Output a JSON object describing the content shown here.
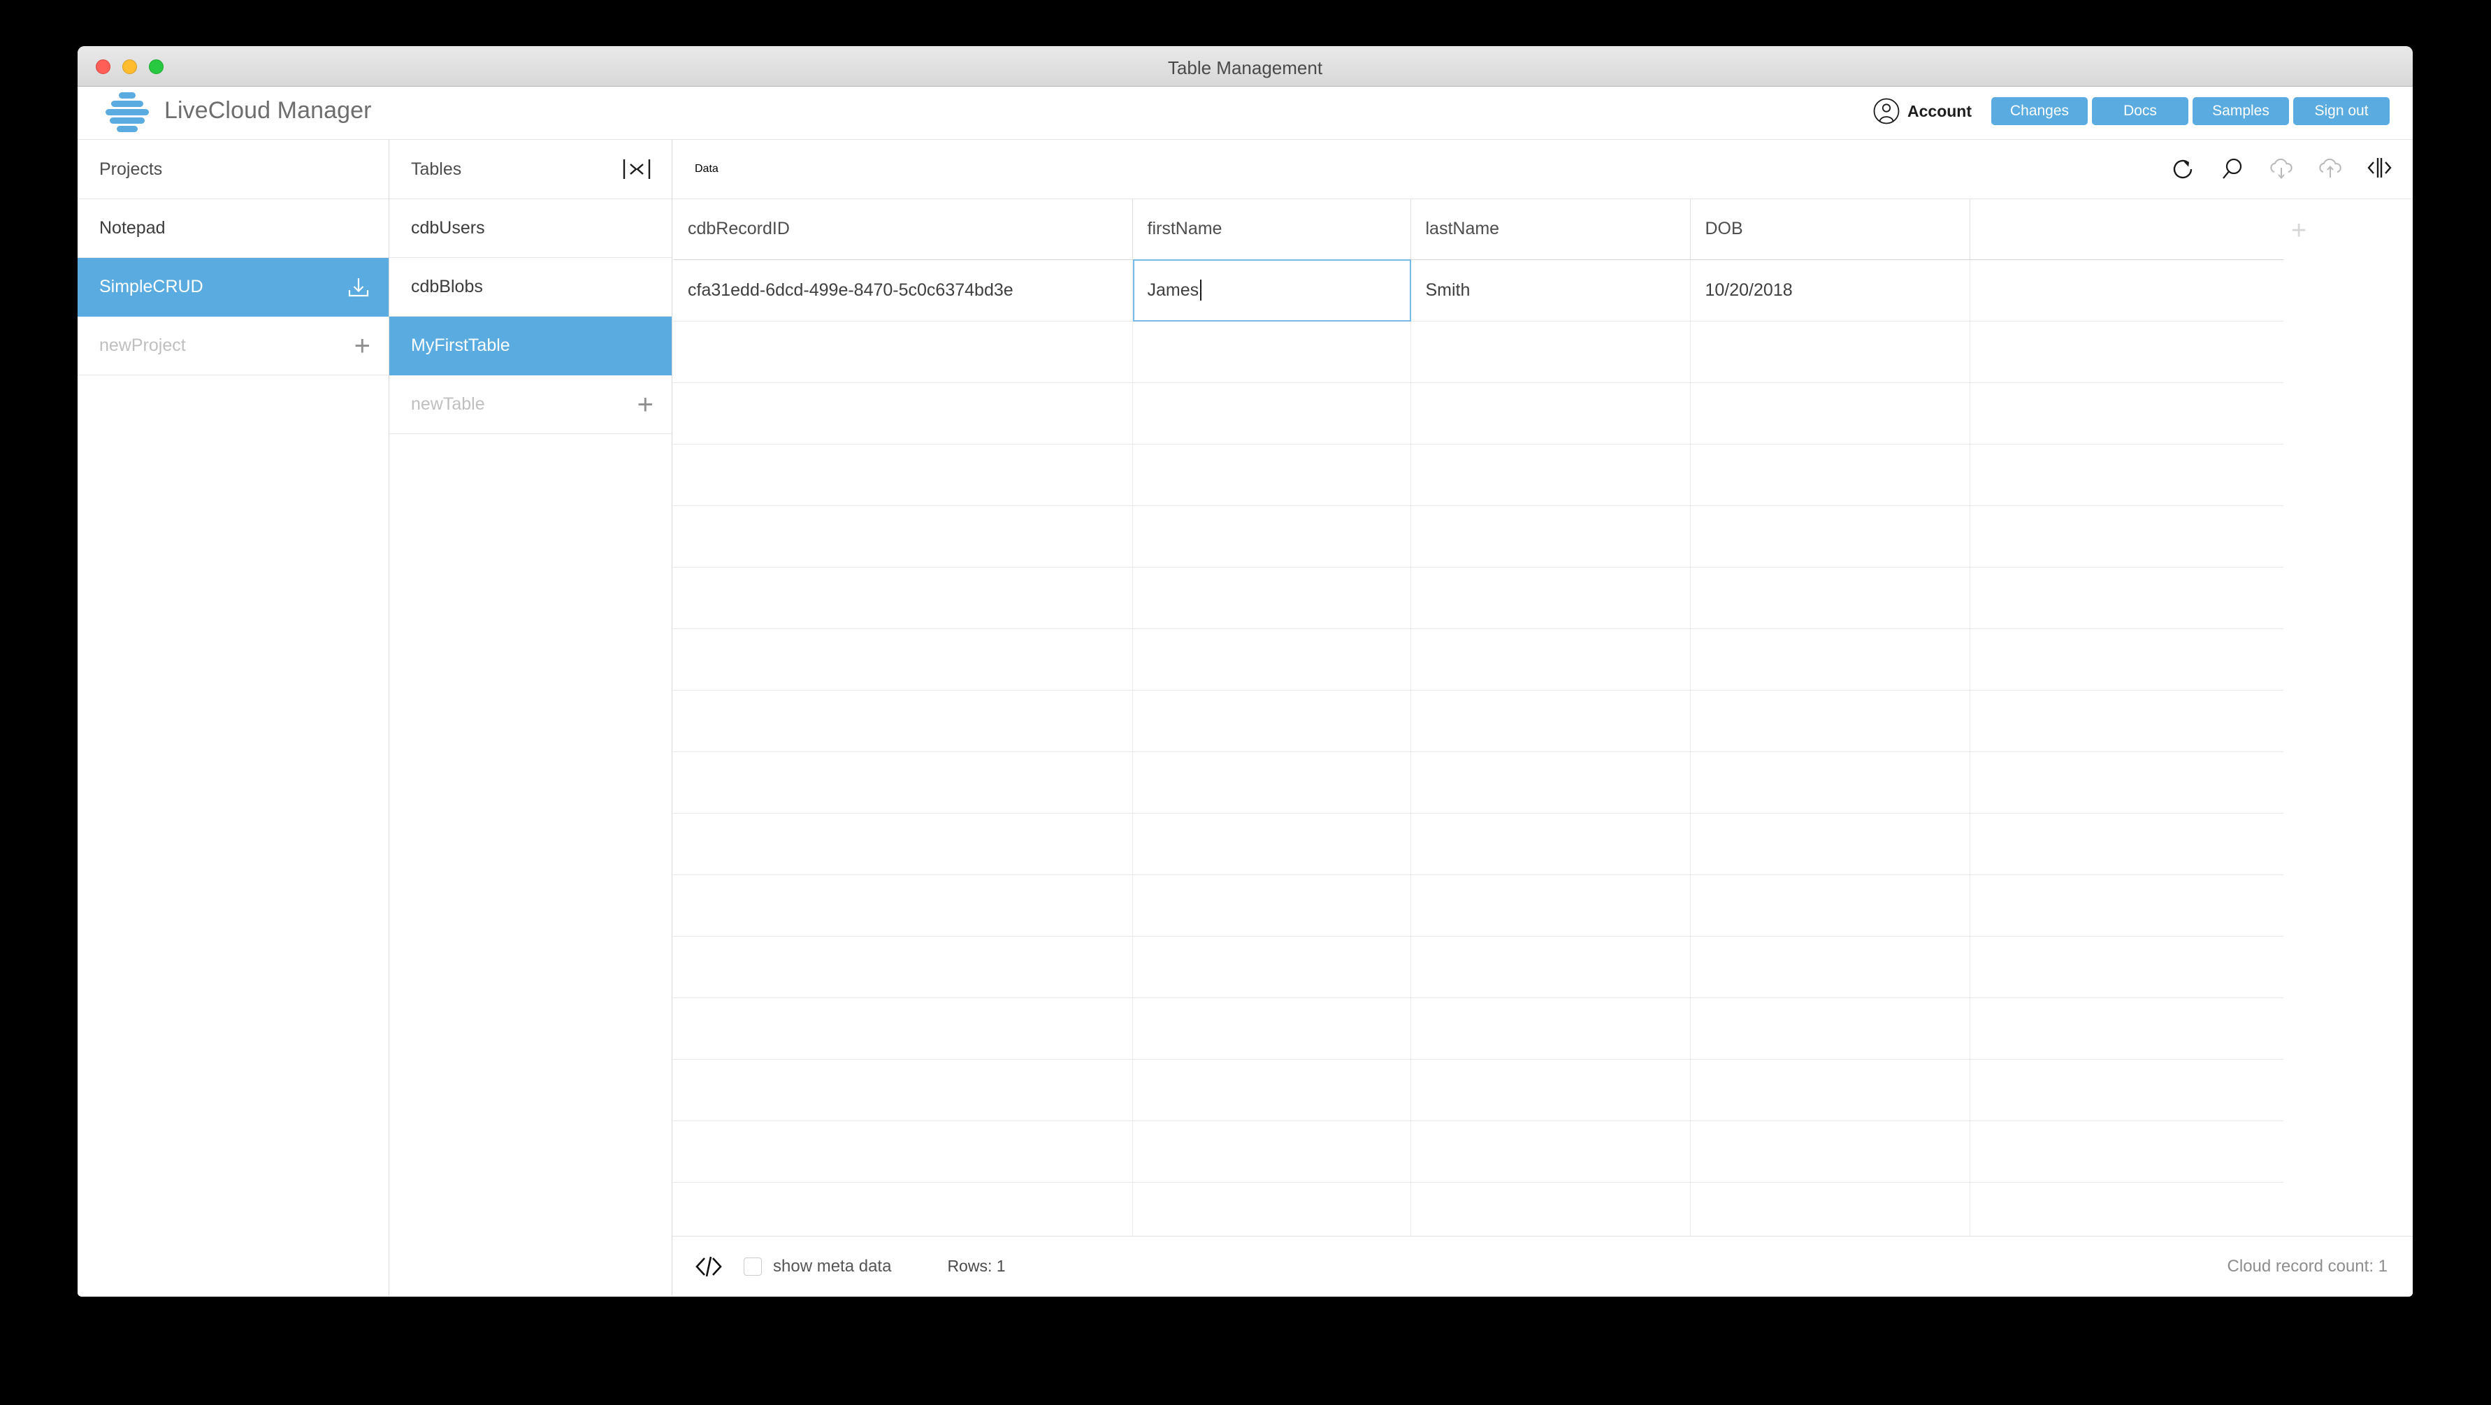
{
  "window": {
    "title": "Table Management",
    "traffic_lights": [
      "close",
      "minimize",
      "zoom"
    ]
  },
  "header": {
    "brand_name": "LiveCloud Manager",
    "logo_icon": "livecloud-stack-logo",
    "account_icon": "account-person-icon",
    "account_label": "Account",
    "buttons": [
      {
        "label": "Changes",
        "name": "changes-button"
      },
      {
        "label": "Docs",
        "name": "docs-button"
      },
      {
        "label": "Samples",
        "name": "samples-button"
      },
      {
        "label": "Sign out",
        "name": "sign-out-button"
      }
    ],
    "accent_color": "#5aabe0"
  },
  "projects_panel": {
    "title": "Projects",
    "items": [
      {
        "label": "Notepad",
        "selected": false,
        "placeholder": false,
        "icon": ""
      },
      {
        "label": "SimpleCRUD",
        "selected": true,
        "placeholder": false,
        "icon": "download-icon"
      },
      {
        "label": "newProject",
        "selected": false,
        "placeholder": true,
        "icon": "plus-icon"
      }
    ]
  },
  "tables_panel": {
    "title": "Tables",
    "collapse_icon": "collapse-horizontal-icon",
    "items": [
      {
        "label": "cdbUsers",
        "selected": false,
        "placeholder": false,
        "icon": ""
      },
      {
        "label": "cdbBlobs",
        "selected": false,
        "placeholder": false,
        "icon": ""
      },
      {
        "label": "MyFirstTable",
        "selected": true,
        "placeholder": false,
        "icon": ""
      },
      {
        "label": "newTable",
        "selected": false,
        "placeholder": true,
        "icon": "plus-icon"
      }
    ]
  },
  "data_panel": {
    "title": "Data",
    "tools": [
      {
        "name": "refresh-icon",
        "enabled": true
      },
      {
        "name": "search-icon",
        "enabled": true
      },
      {
        "name": "cloud-download-icon",
        "enabled": false
      },
      {
        "name": "cloud-upload-icon",
        "enabled": false
      },
      {
        "name": "expand-panel-icon",
        "enabled": true
      }
    ],
    "add_column_label": "+",
    "columns": [
      "cdbRecordID",
      "firstName",
      "lastName",
      "DOB",
      ""
    ],
    "rows": [
      {
        "cdbRecordID": "cfa31edd-6dcd-499e-8470-5c0c6374bd3e",
        "firstName": "James",
        "lastName": "Smith",
        "DOB": "10/20/2018",
        "extra": ""
      }
    ],
    "empty_row_count": 15,
    "editing_cell": {
      "row": 0,
      "column": "firstName",
      "value": "James"
    }
  },
  "footer": {
    "code_icon": "code-brackets-icon",
    "show_meta_data_label": "show meta data",
    "show_meta_data_checked": false,
    "rows_label": "Rows: 1",
    "cloud_record_count_label": "Cloud record count: 1"
  }
}
